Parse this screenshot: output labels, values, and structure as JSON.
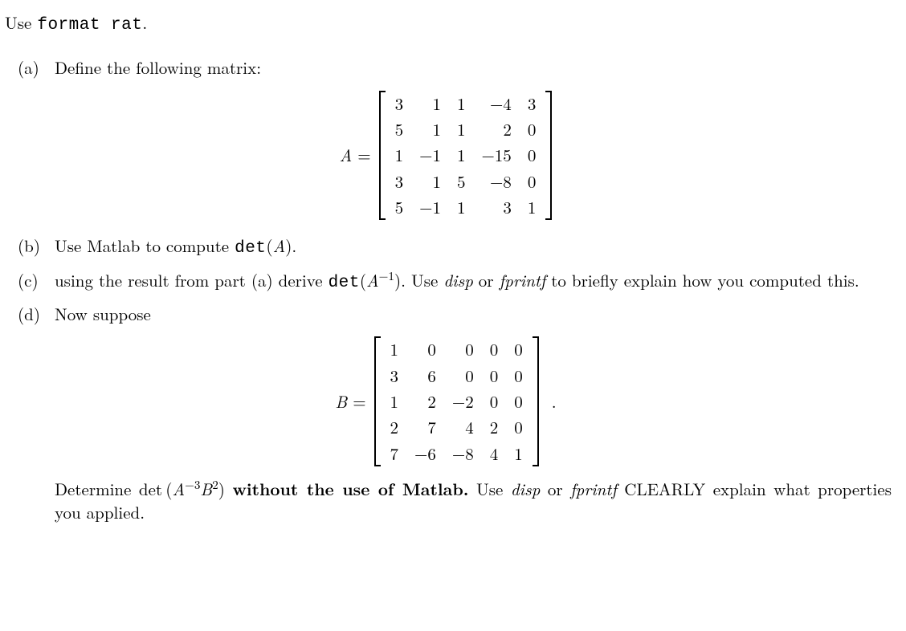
{
  "intro": {
    "pre": "Use ",
    "cmd": "format rat",
    "post": "."
  },
  "parts": {
    "a": {
      "label": "(a)",
      "text": "Define the following matrix:"
    },
    "b": {
      "label": "(b)",
      "t1": "Use Matlab to compute ",
      "code": "det",
      "t2": "(",
      "var": "A",
      "t3": ")."
    },
    "c": {
      "label": "(c)",
      "t1": "using the result from part (a) derive ",
      "code": "det",
      "t2": "(",
      "var": "A",
      "sup": "−1",
      "t3": ").  Use ",
      "disp": "disp",
      "t4": " or ",
      "fprintf": "fprintf",
      "t5": " to briefly explain how you computed this."
    },
    "d": {
      "label": "(d)",
      "text": "Now suppose"
    },
    "d2": {
      "t1": "Determine det (",
      "var": "A",
      "supA": "−3",
      "varB": "B",
      "supB": "2",
      "t2": ") ",
      "bold": "without the use of Matlab.",
      "t3": " Use ",
      "disp": "disp",
      "t4": " or ",
      "fprintf": "fprintf",
      "t5": " CLEARLY explain what properties you applied."
    }
  },
  "matrixA": {
    "lhs_var": "A",
    "eq": " = ",
    "rows": [
      [
        "3",
        "1",
        "1",
        "−4",
        "3"
      ],
      [
        "5",
        "1",
        "1",
        "2",
        "0"
      ],
      [
        "1",
        "−1",
        "1",
        "−15",
        "0"
      ],
      [
        "3",
        "1",
        "5",
        "−8",
        "0"
      ],
      [
        "5",
        "−1",
        "1",
        "3",
        "1"
      ]
    ]
  },
  "matrixB": {
    "lhs_var": "B",
    "eq": " = ",
    "rows": [
      [
        "1",
        "0",
        "0",
        "0",
        "0"
      ],
      [
        "3",
        "6",
        "0",
        "0",
        "0"
      ],
      [
        "1",
        "2",
        "−2",
        "0",
        "0"
      ],
      [
        "2",
        "7",
        "4",
        "2",
        "0"
      ],
      [
        "7",
        "−6",
        "−8",
        "4",
        "1"
      ]
    ],
    "period": "."
  }
}
